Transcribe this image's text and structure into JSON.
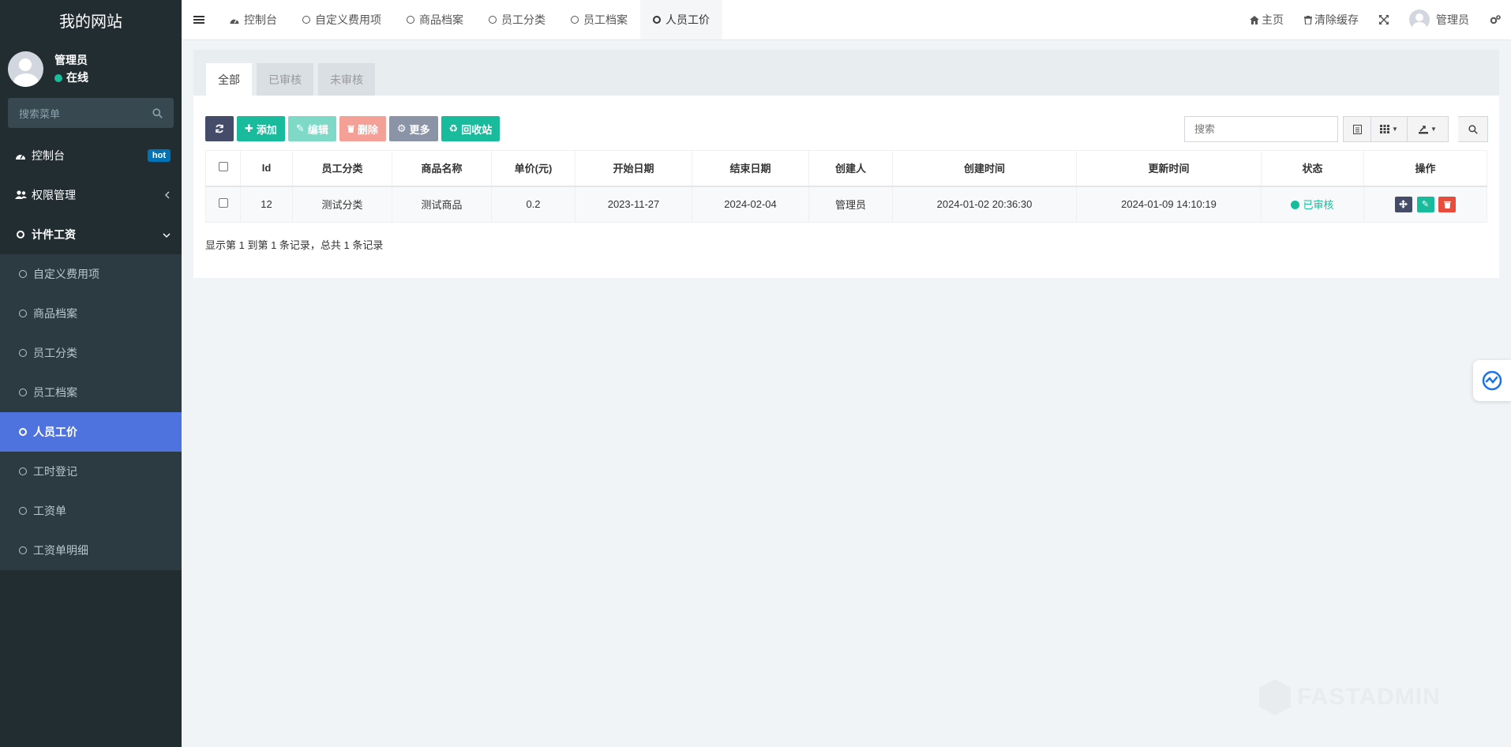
{
  "brand": "我的网站",
  "user": {
    "name": "管理员",
    "status": "在线"
  },
  "sidebar": {
    "search_placeholder": "搜索菜单",
    "items": [
      {
        "label": "控制台",
        "badge": "hot",
        "icon": "dashboard-icon"
      },
      {
        "label": "权限管理",
        "icon": "users-icon"
      },
      {
        "label": "计件工资",
        "icon": "circle-icon"
      }
    ],
    "subitems": [
      "自定义费用项",
      "商品档案",
      "员工分类",
      "员工档案",
      "人员工价",
      "工时登记",
      "工资单",
      "工资单明细"
    ],
    "active_subitem": "人员工价"
  },
  "topnav": {
    "tabs": [
      "控制台",
      "自定义费用项",
      "商品档案",
      "员工分类",
      "员工档案",
      "人员工价"
    ],
    "right": {
      "home": "主页",
      "clear_cache": "清除缓存",
      "user": "管理员"
    }
  },
  "panel": {
    "tabs": [
      "全部",
      "已审核",
      "未审核"
    ],
    "toolbar": {
      "add": "添加",
      "edit": "编辑",
      "delete": "删除",
      "more": "更多",
      "recycle": "回收站"
    },
    "search_placeholder": "搜索",
    "table": {
      "columns": [
        "Id",
        "员工分类",
        "商品名称",
        "单价(元)",
        "开始日期",
        "结束日期",
        "创建人",
        "创建时间",
        "更新时间",
        "状态",
        "操作"
      ],
      "rows": [
        {
          "id": "12",
          "category": "测试分类",
          "product": "测试商品",
          "price": "0.2",
          "start": "2023-11-27",
          "end": "2024-02-04",
          "creator": "管理员",
          "created": "2024-01-02 20:36:30",
          "updated": "2024-01-09 14:10:19",
          "status": "已审核"
        }
      ]
    },
    "footer": "显示第 1 到第 1 条记录，总共 1 条记录"
  },
  "watermark": "FASTADMIN",
  "colors": {
    "accent": "#4e73df",
    "success": "#18bc9c",
    "danger": "#e74c3c",
    "sidebar": "#222d32"
  }
}
